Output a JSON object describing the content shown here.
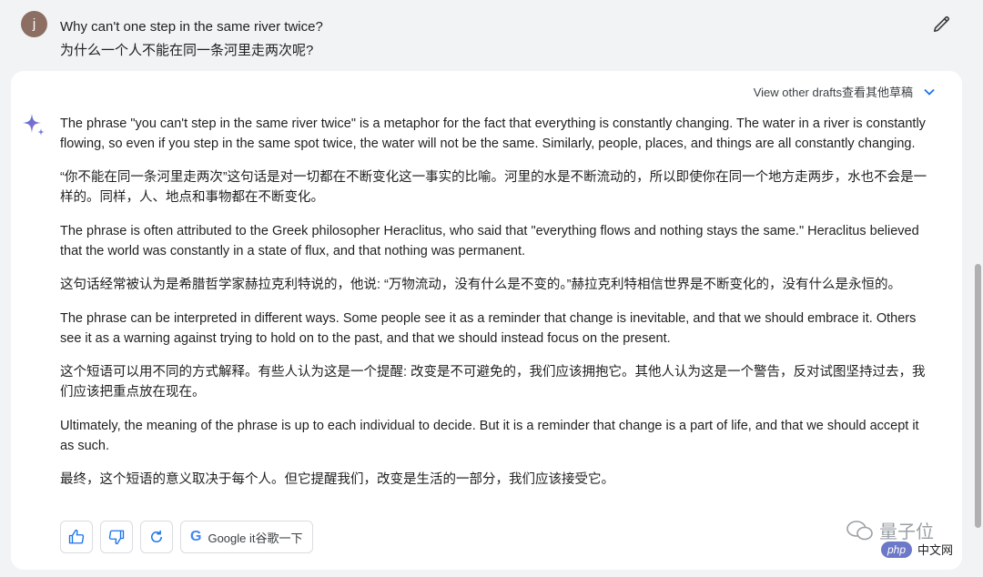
{
  "user": {
    "avatar_letter": "j"
  },
  "prompt": {
    "en": "Why can't one step in the same river twice?",
    "zh": "为什么一个人不能在同一条河里走两次呢?"
  },
  "drafts": {
    "label": "View other drafts查看其他草稿"
  },
  "response": {
    "paragraphs": [
      "The phrase \"you can't step in the same river twice\" is a metaphor for the fact that everything is constantly changing. The water in a river is constantly flowing, so even if you step in the same spot twice, the water will not be the same. Similarly, people, places, and things are all constantly changing.",
      "“你不能在同一条河里走两次”这句话是对一切都在不断变化这一事实的比喻。河里的水是不断流动的，所以即使你在同一个地方走两步，水也不会是一样的。同样，人、地点和事物都在不断变化。",
      "The phrase is often attributed to the Greek philosopher Heraclitus, who said that \"everything flows and nothing stays the same.\" Heraclitus believed that the world was constantly in a state of flux, and that nothing was permanent.",
      "这句话经常被认为是希腊哲学家赫拉克利特说的，他说: “万物流动，没有什么是不变的。”赫拉克利特相信世界是不断变化的，没有什么是永恒的。",
      "The phrase can be interpreted in different ways. Some people see it as a reminder that change is inevitable, and that we should embrace it. Others see it as a warning against trying to hold on to the past, and that we should instead focus on the present.",
      "这个短语可以用不同的方式解释。有些人认为这是一个提醒: 改变是不可避免的，我们应该拥抱它。其他人认为这是一个警告，反对试图坚持过去，我们应该把重点放在现在。",
      "Ultimately, the meaning of the phrase is up to each individual to decide. But it is a reminder that change is a part of life, and that we should accept it as such.",
      "最终，这个短语的意义取决于每个人。但它提醒我们，改变是生活的一部分，我们应该接受它。"
    ]
  },
  "actions": {
    "thumbs_up_icon": "thumbs-up-icon",
    "thumbs_down_icon": "thumbs-down-icon",
    "regenerate_icon": "refresh-icon",
    "google_label": "Google it谷歌一下"
  },
  "watermark": {
    "name": "量子位",
    "badge": "php",
    "site": "中文网"
  },
  "colors": {
    "accent": "#1a73e8",
    "avatar_bg": "#8d6e63",
    "page_bg": "#f1f3f4"
  }
}
